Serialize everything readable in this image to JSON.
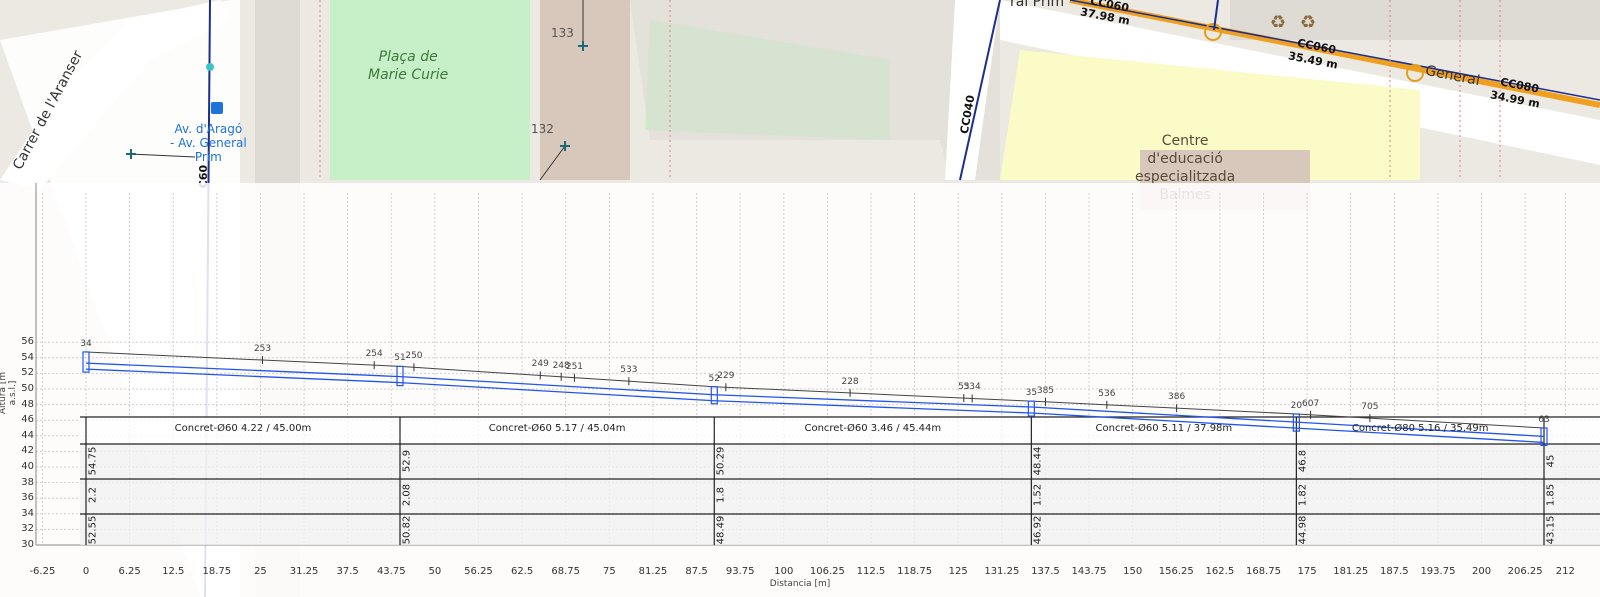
{
  "map": {
    "park_name": "Plaça de\nMarie Curie",
    "building_numbers": [
      "133",
      "132"
    ],
    "street_left": "Carrer de l'Aranser",
    "street_top_right": "ral Prim",
    "street_right": "General",
    "bus_stop": "Av. d'Aragó\n- Av. General\nPrim",
    "school": "Centre\nd'educació\nespecialitzada\nBalmes",
    "pipe_labels": [
      {
        "code": "CC060",
        "length": "37.98 m"
      },
      {
        "code": "CC060",
        "length": "35.49 m"
      },
      {
        "code": "CC080",
        "length": "34.99 m"
      }
    ],
    "vertical_pipe_codes": [
      "CC040",
      "C60"
    ],
    "recycle_icons": 2,
    "colors": {
      "pipe_blue": "#1a2f8f",
      "main_pipe_orange": "#f0a020",
      "park_green": "#c8f0c8",
      "school_yellow": "#fbfbc8",
      "node_cyan": "#3fc4c8",
      "bus_blue": "#1e72d8"
    }
  },
  "profile": {
    "y_axis_label": "Altura [m a.s.l.]",
    "x_axis_label": "Distancia [m]",
    "y_ticks": [
      "56",
      "54",
      "52",
      "50",
      "48",
      "46",
      "44",
      "42",
      "40",
      "38",
      "36",
      "34",
      "32",
      "30"
    ],
    "x_ticks": [
      "-6.25",
      "0",
      "6.25",
      "12.5",
      "18.75",
      "25",
      "31.25",
      "37.5",
      "43.75",
      "50",
      "56.25",
      "62.5",
      "68.75",
      "75",
      "81.25",
      "87.5",
      "93.75",
      "100",
      "106.25",
      "112.5",
      "118.75",
      "125",
      "131.25",
      "137.5",
      "143.75",
      "150",
      "156.25",
      "162.5",
      "168.75",
      "175",
      "181.25",
      "187.5",
      "193.75",
      "200",
      "206.25",
      "212"
    ],
    "segments": [
      {
        "label": "Concret-Ø60 4.22 / 45.00m",
        "ground": "54.75",
        "depth": "2.2",
        "invert": "52.55"
      },
      {
        "label": "Concret-Ø60 5.17 / 45.04m",
        "ground": "52.9",
        "depth": "2.08",
        "invert": "50.82"
      },
      {
        "label": "Concret-Ø60 3.46 / 45.44m",
        "ground": "50.29",
        "depth": "1.8",
        "invert": "48.49"
      },
      {
        "label": "Concret-Ø60 5.11 / 37.98m",
        "ground": "48.44",
        "depth": "1.52",
        "invert": "46.92"
      },
      {
        "label": "Concret-Ø80 5.16 / 35.49m",
        "ground": "46.8",
        "depth": "1.82",
        "invert": "44.98"
      },
      {
        "label": "",
        "ground": "45",
        "depth": "1.85",
        "invert": "43.15"
      }
    ],
    "manholes": [
      "34",
      "51",
      "52",
      "35",
      "20",
      "63"
    ],
    "ground_point_labels": [
      "253",
      "254",
      "250",
      "249",
      "248",
      "251",
      "533",
      "229",
      "228",
      "53",
      "534",
      "385",
      "536",
      "386",
      "607",
      "705"
    ],
    "colors": {
      "pipe": "#2255ee",
      "ground": "#444444",
      "grid": "#cfcfcf"
    }
  },
  "chart_data": {
    "type": "line",
    "xlabel": "Distancia [m]",
    "ylabel": "Altura [m a.s.l.]",
    "xlim": [
      -6.25,
      212
    ],
    "ylim": [
      30,
      56
    ],
    "series": [
      {
        "name": "",
        "x": [
          0,
          45.0,
          90.04,
          135.48,
          173.46,
          208.95
        ],
        "values": [
          54.75,
          52.9,
          50.29,
          48.44,
          46.8,
          45.0
        ]
      },
      {
        "name": "",
        "x": [
          0,
          45.0,
          90.04,
          135.48,
          173.46,
          208.95
        ],
        "values": [
          52.55,
          50.82,
          48.49,
          46.92,
          44.98,
          43.15
        ]
      }
    ],
    "manhole_positions": [
      0,
      45.0,
      90.04,
      135.48,
      173.46,
      208.95
    ],
    "ground_points": [
      {
        "label": "253",
        "x": 25.3
      },
      {
        "label": "254",
        "x": 41.3
      },
      {
        "label": "250",
        "x": 47.0
      },
      {
        "label": "249",
        "x": 65.1
      },
      {
        "label": "248",
        "x": 68.1
      },
      {
        "label": "251",
        "x": 70.0
      },
      {
        "label": "533",
        "x": 77.8
      },
      {
        "label": "229",
        "x": 91.7
      },
      {
        "label": "228",
        "x": 109.5
      },
      {
        "label": "53",
        "x": 125.8
      },
      {
        "label": "534",
        "x": 127.0
      },
      {
        "label": "385",
        "x": 137.5
      },
      {
        "label": "536",
        "x": 146.3
      },
      {
        "label": "386",
        "x": 156.3
      },
      {
        "label": "607",
        "x": 175.5
      },
      {
        "label": "705",
        "x": 184.0
      }
    ]
  }
}
